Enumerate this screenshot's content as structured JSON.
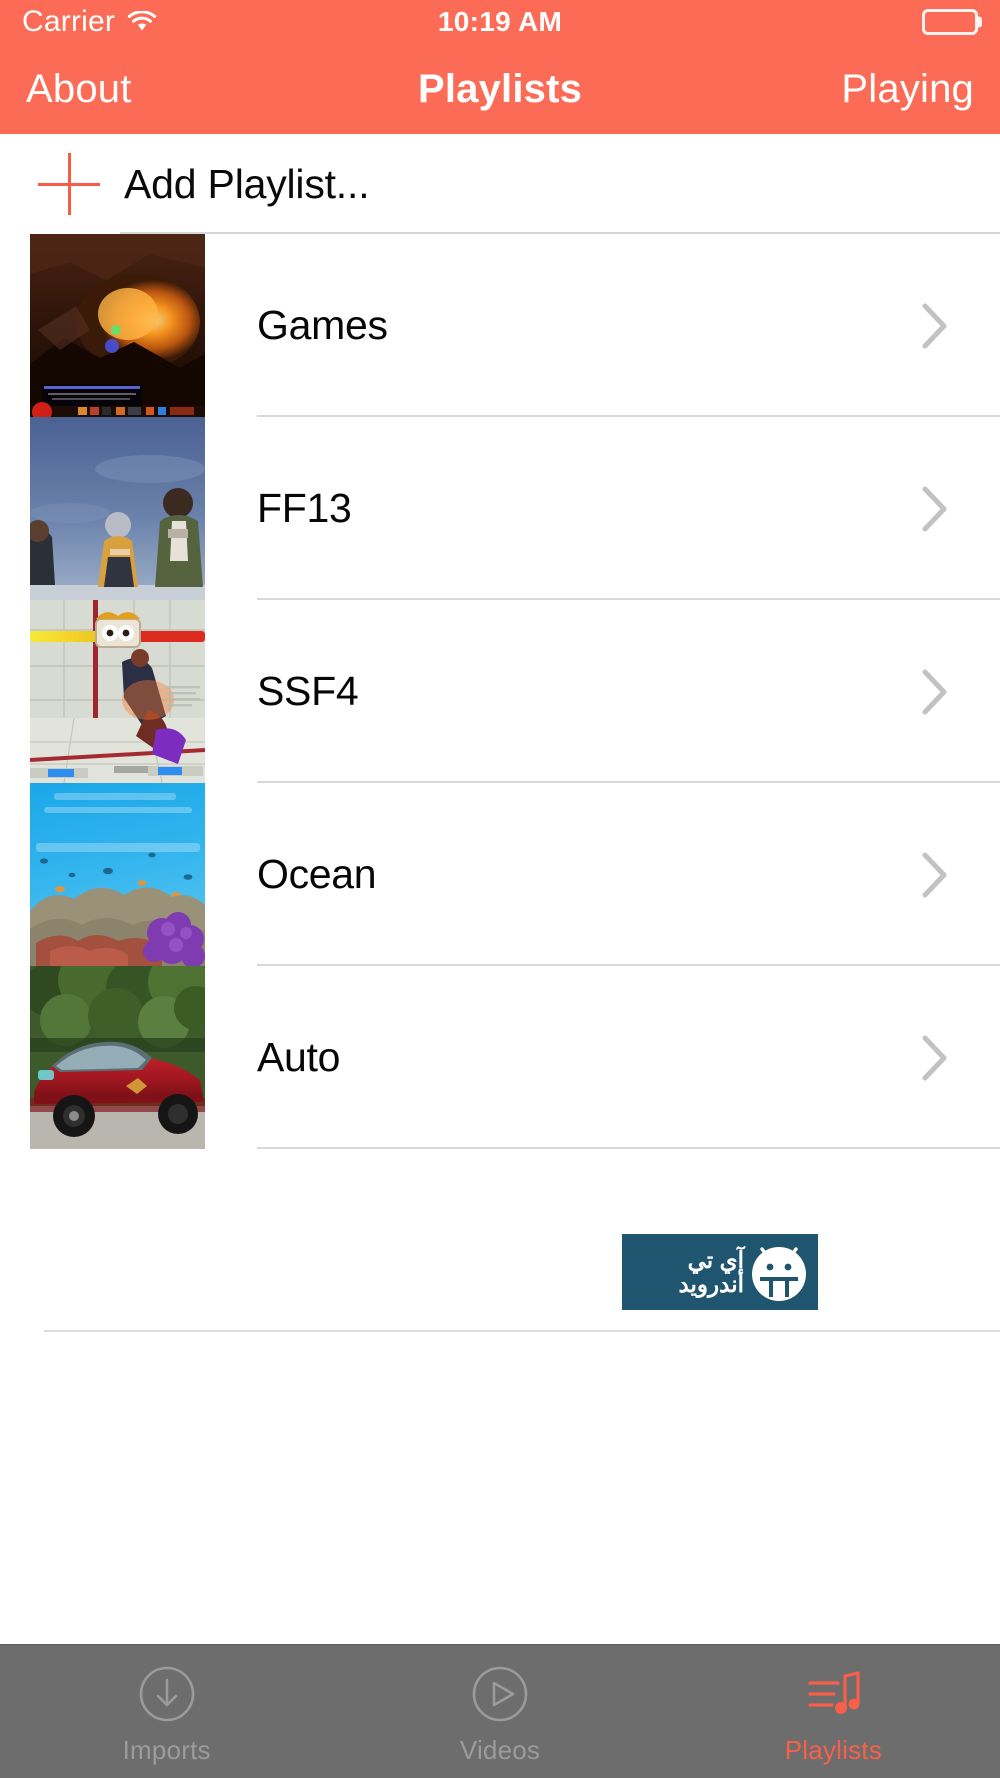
{
  "status_bar": {
    "carrier": "Carrier",
    "wifi_icon": "wifi-icon",
    "time": "10:19 AM",
    "battery_icon": "battery-full-icon"
  },
  "nav_bar": {
    "left_button": "About",
    "title": "Playlists",
    "right_button": "Playing"
  },
  "add_row": {
    "icon": "plus-icon",
    "label": "Add Playlist..."
  },
  "playlists": [
    {
      "title": "Games",
      "thumb": "dark-cave-fire-game-screenshot",
      "chevron": "chevron-right-icon"
    },
    {
      "title": "FF13",
      "thumb": "blue-sky-characters-screenshot",
      "chevron": "chevron-right-icon"
    },
    {
      "title": "SSF4",
      "thumb": "fighting-game-health-bars-screenshot",
      "chevron": "chevron-right-icon"
    },
    {
      "title": "Ocean",
      "thumb": "coral-reef-underwater-photo",
      "chevron": "chevron-right-icon"
    },
    {
      "title": "Auto",
      "thumb": "red-sports-car-photo",
      "chevron": "chevron-right-icon"
    }
  ],
  "watermark": {
    "line1": "آي تي",
    "line2": "أندرويد",
    "robot_icon": "android-robot-icon",
    "background_color": "#1f556e"
  },
  "tab_bar": {
    "items": [
      {
        "label": "Imports",
        "icon": "download-circle-icon",
        "active": false
      },
      {
        "label": "Videos",
        "icon": "play-circle-icon",
        "active": false
      },
      {
        "label": "Playlists",
        "icon": "music-notes-icon",
        "active": true
      }
    ]
  },
  "colors": {
    "accent": "#fb6b56",
    "accent_active": "#f8604a",
    "tab_bar_background": "#6d6d6d",
    "separator": "#d9d9d9"
  }
}
